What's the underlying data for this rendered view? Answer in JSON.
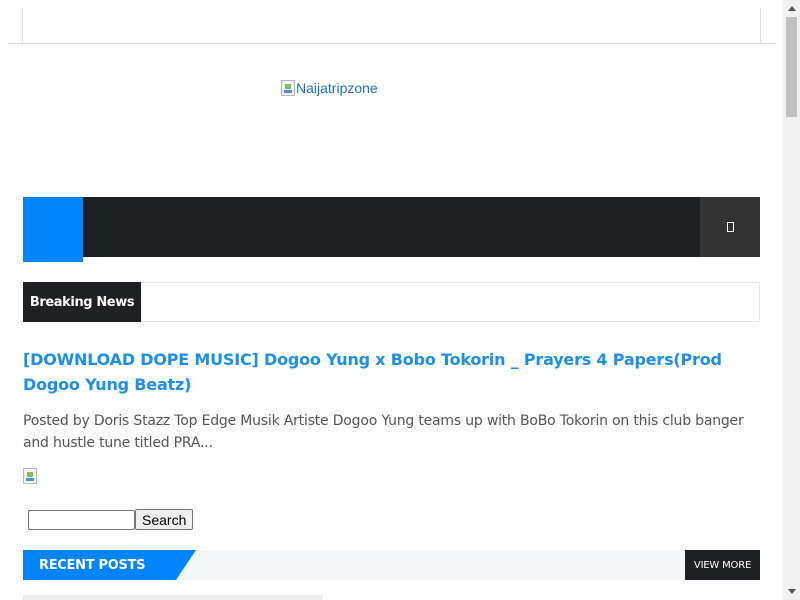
{
  "header": {
    "logo_alt": "Naijatripzone"
  },
  "navbar": {
    "search_icon": "search-icon"
  },
  "breaking_news": {
    "label": "Breaking News"
  },
  "article": {
    "title": "[DOWNLOAD DOPE MUSIC] Dogoo Yung x Bobo Tokorin _ Prayers 4 Papers(Prod Dogoo Yung Beatz)",
    "excerpt": "Posted by Doris Stazz Top Edge Musik Artiste  Dogoo Yung teams up with BoBo Tokorin on this club banger and hustle tune titled PRA..."
  },
  "search": {
    "button_label": "Search",
    "value": ""
  },
  "recent_posts": {
    "label": "RECENT POSTS",
    "view_more": "VIEW MORE"
  },
  "colors": {
    "accent": "#0085ff",
    "dark": "#1f2024",
    "link": "#1e8fe8"
  }
}
